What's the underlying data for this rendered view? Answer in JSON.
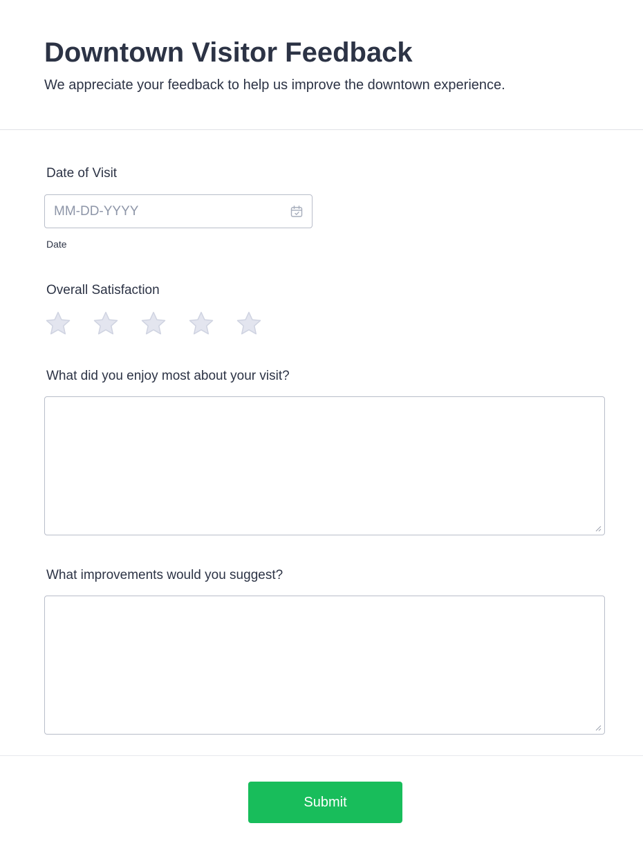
{
  "header": {
    "title": "Downtown Visitor Feedback",
    "subtitle": "We appreciate your feedback to help us improve the downtown experience."
  },
  "date_field": {
    "label": "Date of Visit",
    "placeholder": "MM-DD-YYYY",
    "value": "",
    "sublabel": "Date",
    "icon": "calendar-icon"
  },
  "rating": {
    "label": "Overall Satisfaction",
    "max_stars": 5,
    "selected": 0,
    "icon": "star-icon",
    "empty_color": "#e3e5ef",
    "empty_stroke": "#cfd3e1"
  },
  "enjoy_field": {
    "label": "What did you enjoy most about your visit?",
    "value": ""
  },
  "improve_field": {
    "label": "What improvements would you suggest?",
    "value": ""
  },
  "submit": {
    "label": "Submit",
    "color": "#18bd5b"
  }
}
